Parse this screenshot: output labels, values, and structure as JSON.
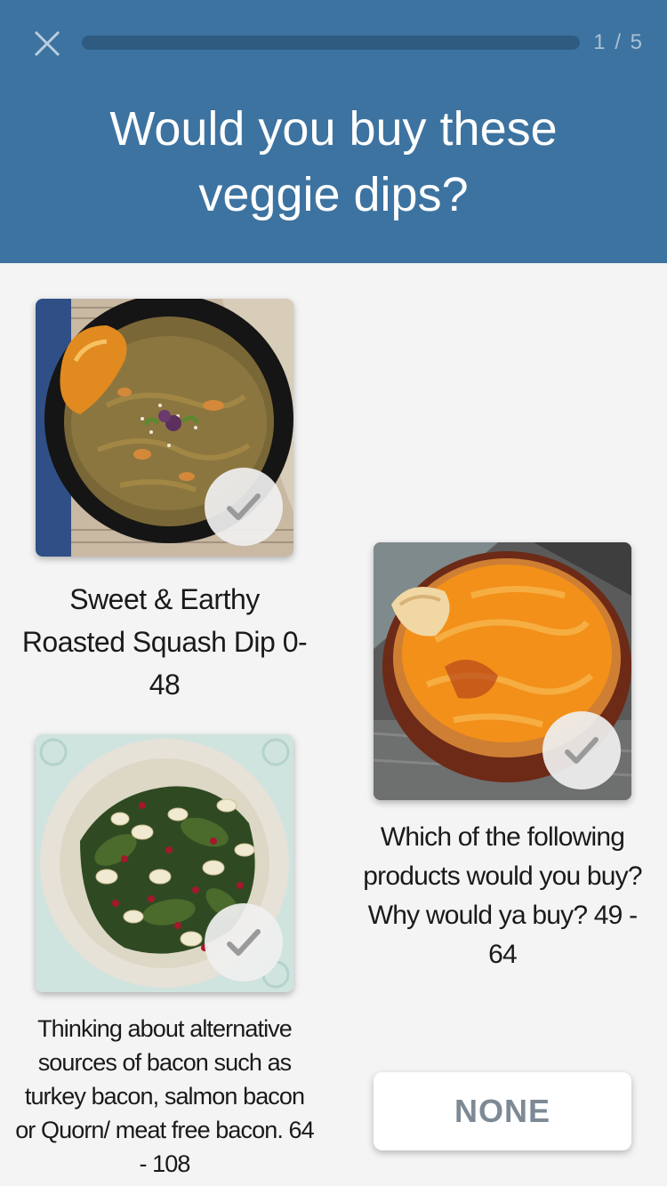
{
  "header": {
    "progress_label": "1 / 5",
    "progress_value": 0.0,
    "title": "Would you buy these veggie dips?"
  },
  "options": [
    {
      "caption": "Sweet & Earthy Roasted Squash Dip 0-48",
      "image_icon": "squash-dip-photo",
      "selected": false
    },
    {
      "caption": "Which of the following products would you buy? Why would ya buy? 49 - 64",
      "image_icon": "carrot-hummus-photo",
      "selected": false
    },
    {
      "caption": "Thinking about alternative sources of bacon such as turkey bacon, salmon bacon or Quorn/ meat free bacon. 64 - 108",
      "image_icon": "bean-salad-photo",
      "selected": false
    }
  ],
  "none_button": {
    "label": "NONE"
  },
  "colors": {
    "header_bg": "#3d73a0",
    "background": "#f4f4f4",
    "check_color": "#9a9a9a",
    "none_text": "#7d8a96"
  }
}
